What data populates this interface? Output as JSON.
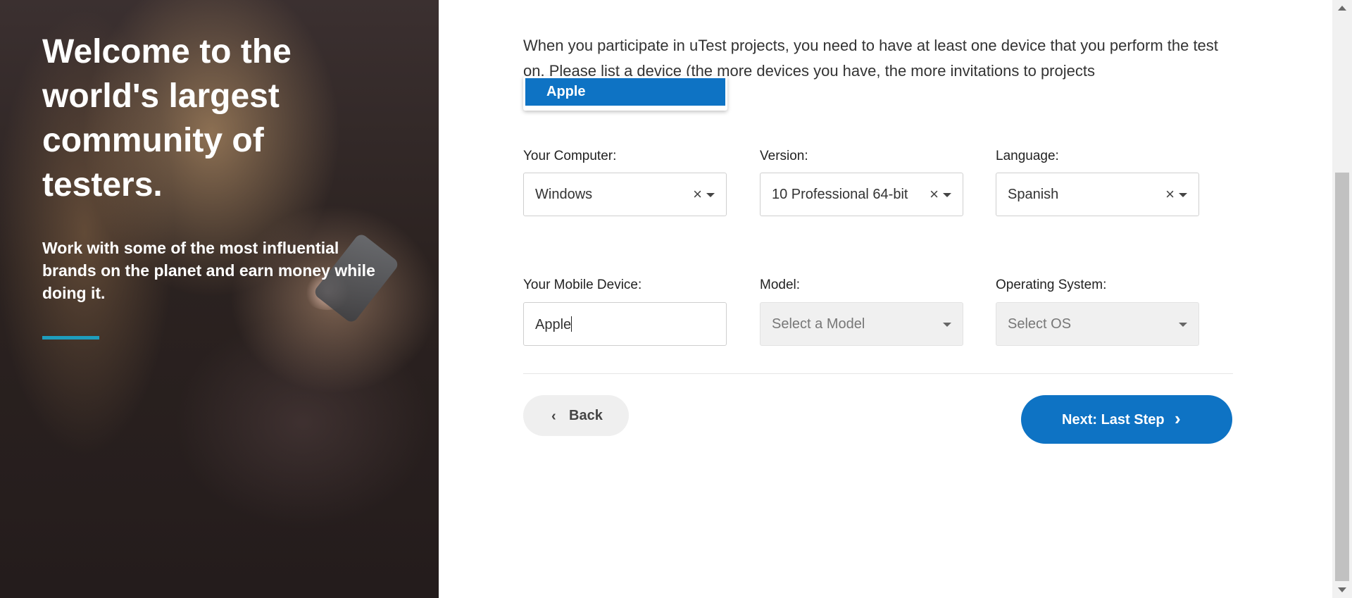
{
  "hero": {
    "title": "Welcome to the world's largest community of testers.",
    "subtitle": "Work with some of the most influential brands on the planet and earn money while doing it.",
    "accent_color": "#1e9dbd"
  },
  "intro_text": "When you participate in uTest projects, you need to have at least one device that you perform the test on. Please list a device (the more devices you have, the more invitations to projects",
  "dropdown": {
    "options": [
      "Apple"
    ],
    "highlight_color": "#0e73c4"
  },
  "computer": {
    "label": "Your Computer:",
    "value": "Windows",
    "clear_icon": "×"
  },
  "version": {
    "label": "Version:",
    "value": "10 Professional 64-bit",
    "clear_icon": "×"
  },
  "language": {
    "label": "Language:",
    "value": "Spanish",
    "clear_icon": "×"
  },
  "mobile": {
    "label": "Your Mobile Device:",
    "value": "Apple"
  },
  "model": {
    "label": "Model:",
    "placeholder": "Select a Model"
  },
  "os": {
    "label": "Operating System:",
    "placeholder": "Select OS"
  },
  "buttons": {
    "back_label": "Back",
    "back_icon": "‹",
    "next_label": "Next: Last Step",
    "next_icon": "›",
    "primary_color": "#0e73c4"
  }
}
